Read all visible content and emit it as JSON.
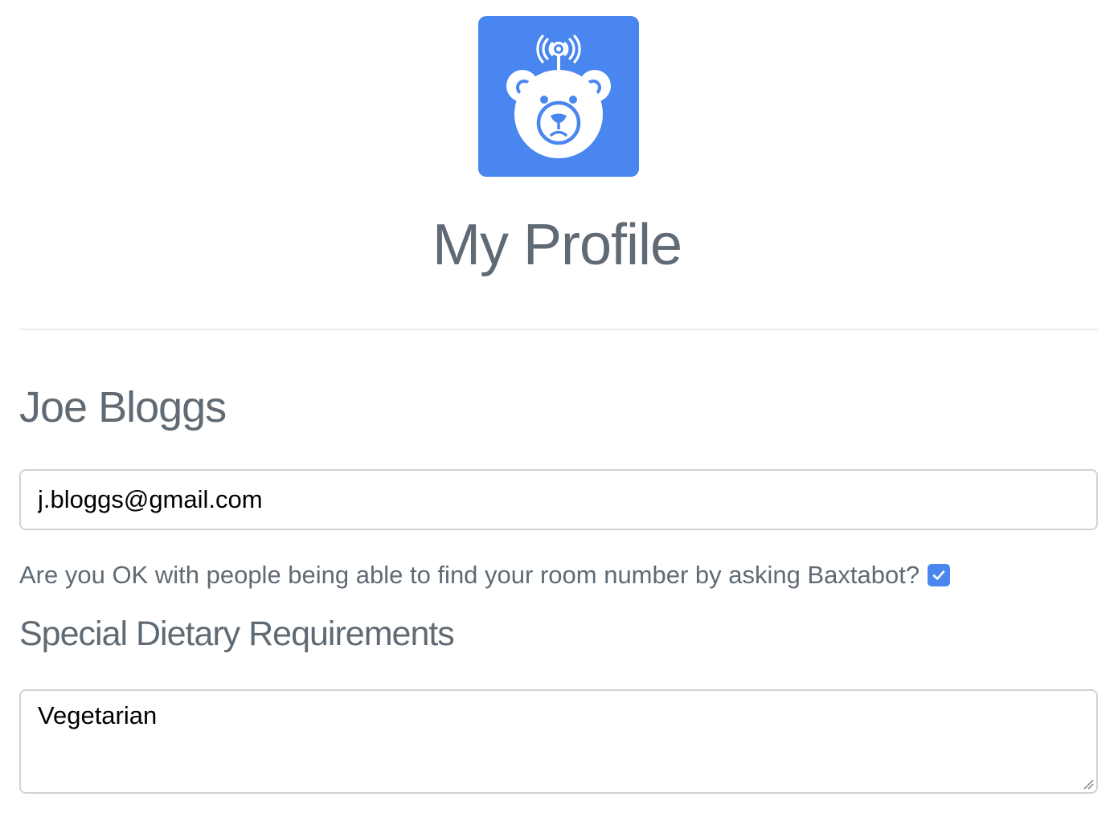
{
  "header": {
    "logo_icon": "bear-robot-antenna-icon",
    "logo_color": "#4a86f0",
    "title": "My Profile"
  },
  "profile": {
    "name": "Joe Bloggs",
    "email": "j.bloggs@gmail.com",
    "room_consent": {
      "label": "Are you OK with people being able to find your room number by asking Baxtabot?",
      "checked": true
    },
    "dietary": {
      "heading": "Special Dietary Requirements",
      "value": "Vegetarian"
    }
  },
  "colors": {
    "accent": "#4a86f0",
    "text_muted": "#5f6a74",
    "input_border": "#ced3d8"
  }
}
